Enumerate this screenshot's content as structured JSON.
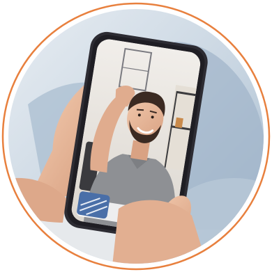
{
  "image": {
    "subject": "",
    "colors": {
      "ring": "#E8803E",
      "background_blue": "#A9BDD0",
      "wall": "#E9E4DE",
      "skin": "#E7B89A",
      "shirt": "#8E9094",
      "hair": "#3B2A22",
      "phone_frame": "#2D2C33",
      "hang_up_button": "#E7453E"
    },
    "icons": [
      "hang-up-icon"
    ]
  }
}
